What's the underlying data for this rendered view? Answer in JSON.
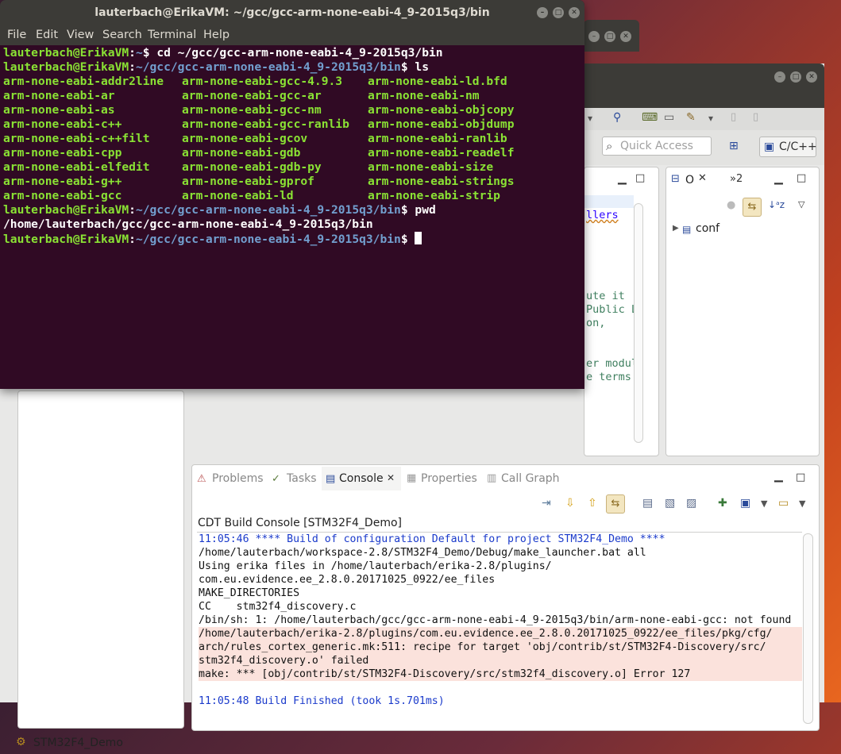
{
  "terminal": {
    "title": "lauterbach@ErikaVM: ~/gcc/gcc-arm-none-eabi-4_9-2015q3/bin",
    "menu": [
      "File",
      "Edit",
      "View",
      "Search",
      "Terminal",
      "Help"
    ],
    "prompt_user": "lauterbach@ErikaVM",
    "lines": [
      {
        "path": "~",
        "cmd": "cd ~/gcc/gcc-arm-none-eabi-4_9-2015q3/bin"
      },
      {
        "path": "~/gcc/gcc-arm-none-eabi-4_9-2015q3/bin",
        "cmd": "ls"
      }
    ],
    "ls_output": [
      [
        "arm-none-eabi-addr2line",
        "arm-none-eabi-gcc-4.9.3",
        "arm-none-eabi-ld.bfd"
      ],
      [
        "arm-none-eabi-ar",
        "arm-none-eabi-gcc-ar",
        "arm-none-eabi-nm"
      ],
      [
        "arm-none-eabi-as",
        "arm-none-eabi-gcc-nm",
        "arm-none-eabi-objcopy"
      ],
      [
        "arm-none-eabi-c++",
        "arm-none-eabi-gcc-ranlib",
        "arm-none-eabi-objdump"
      ],
      [
        "arm-none-eabi-c++filt",
        "arm-none-eabi-gcov",
        "arm-none-eabi-ranlib"
      ],
      [
        "arm-none-eabi-cpp",
        "arm-none-eabi-gdb",
        "arm-none-eabi-readelf"
      ],
      [
        "arm-none-eabi-elfedit",
        "arm-none-eabi-gdb-py",
        "arm-none-eabi-size"
      ],
      [
        "arm-none-eabi-g++",
        "arm-none-eabi-gprof",
        "arm-none-eabi-strings"
      ],
      [
        "arm-none-eabi-gcc",
        "arm-none-eabi-ld",
        "arm-none-eabi-strip"
      ]
    ],
    "pwd_line": {
      "path": "~/gcc/gcc-arm-none-eabi-4_9-2015q3/bin",
      "cmd": "pwd"
    },
    "pwd_output": "/home/lauterbach/gcc/gcc-arm-none-eabi-4_9-2015q3/bin",
    "last_prompt_path": "~/gcc/gcc-arm-none-eabi-4_9-2015q3/bin"
  },
  "eclipse": {
    "quick_access_placeholder": "Quick Access",
    "perspective": "C/C++",
    "editor_fragments": [
      "llers",
      "ute it",
      "Public L",
      "on,",
      "er modul",
      "e terms"
    ],
    "outline": {
      "tab_label": "O",
      "tab_overflow": "»2",
      "tree_item": "conf"
    },
    "console_tabs": [
      "Problems",
      "Tasks",
      "Console",
      "Properties",
      "Call Graph"
    ],
    "console_title": "CDT Build Console [STM32F4_Demo]",
    "console_lines": [
      {
        "text": "11:05:46 **** Build of configuration Default for project STM32F4_Demo ****",
        "style": "blue"
      },
      {
        "text": "/home/lauterbach/workspace-2.8/STM32F4_Demo/Debug/make_launcher.bat all",
        "style": "normal"
      },
      {
        "text": "Using erika files in /home/lauterbach/erika-2.8/plugins/",
        "style": "normal"
      },
      {
        "text": "com.eu.evidence.ee_2.8.0.20171025_0922/ee_files",
        "style": "normal"
      },
      {
        "text": "MAKE_DIRECTORIES",
        "style": "normal"
      },
      {
        "text": "CC    stm32f4_discovery.c",
        "style": "normal"
      },
      {
        "text": "/bin/sh: 1: /home/lauterbach/gcc/gcc-arm-none-eabi-4_9-2015q3/bin/arm-none-eabi-gcc: not found",
        "style": "normal"
      },
      {
        "text": "/home/lauterbach/erika-2.8/plugins/com.eu.evidence.ee_2.8.0.20171025_0922/ee_files/pkg/cfg/",
        "style": "error"
      },
      {
        "text": "arch/rules_cortex_generic.mk:511: recipe for target 'obj/contrib/st/STM32F4-Discovery/src/",
        "style": "error"
      },
      {
        "text": "stm32f4_discovery.o' failed",
        "style": "error"
      },
      {
        "text": "make: *** [obj/contrib/st/STM32F4-Discovery/src/stm32f4_discovery.o] Error 127",
        "style": "error"
      },
      {
        "text": "",
        "style": "normal"
      },
      {
        "text": "11:05:48 Build Finished (took 1s.701ms)",
        "style": "blue"
      }
    ],
    "status_project": "STM32F4_Demo"
  }
}
